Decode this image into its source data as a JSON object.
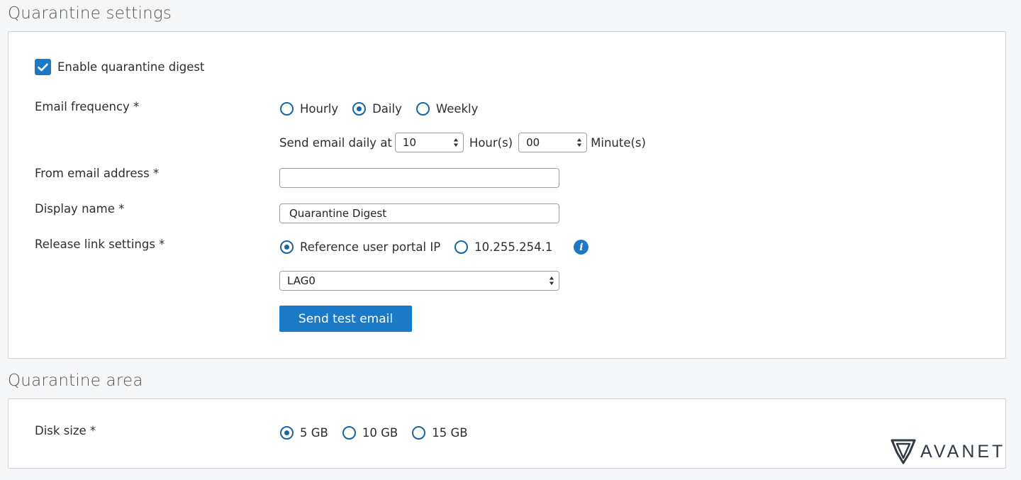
{
  "quarantine_settings": {
    "title": "Quarantine settings",
    "enable_digest": {
      "label": "Enable quarantine digest",
      "checked": true
    },
    "email_frequency": {
      "label": "Email frequency *",
      "options": [
        {
          "label": "Hourly",
          "checked": false
        },
        {
          "label": "Daily",
          "checked": true
        },
        {
          "label": "Weekly",
          "checked": false
        }
      ],
      "send_daily_label": "Send email daily at",
      "hour_value": "10",
      "hour_label": "Hour(s)",
      "minute_value": "00",
      "minute_label": "Minute(s)"
    },
    "from_email": {
      "label": "From email address *",
      "value": ""
    },
    "display_name": {
      "label": "Display name *",
      "value": "Quarantine Digest"
    },
    "release_link": {
      "label": "Release link settings *",
      "options": [
        {
          "label": "Reference user portal IP",
          "checked": true
        },
        {
          "label": "10.255.254.1",
          "checked": false
        }
      ],
      "interface_value": "LAG0"
    },
    "send_test_email": "Send test email"
  },
  "quarantine_area": {
    "title": "Quarantine area",
    "disk_size": {
      "label": "Disk size *",
      "options": [
        {
          "label": "5 GB",
          "checked": true
        },
        {
          "label": "10 GB",
          "checked": false
        },
        {
          "label": "15 GB",
          "checked": false
        }
      ]
    }
  },
  "watermark": {
    "text": "AVANET"
  },
  "colors": {
    "accent": "#1a7ac7",
    "radio": "#1565a8",
    "background": "#f5f6f7"
  },
  "icons": {
    "checkbox": "checkmark-icon",
    "info": "info-icon",
    "select": "up-down-arrows-icon",
    "logo": "avanet-shield-icon"
  }
}
